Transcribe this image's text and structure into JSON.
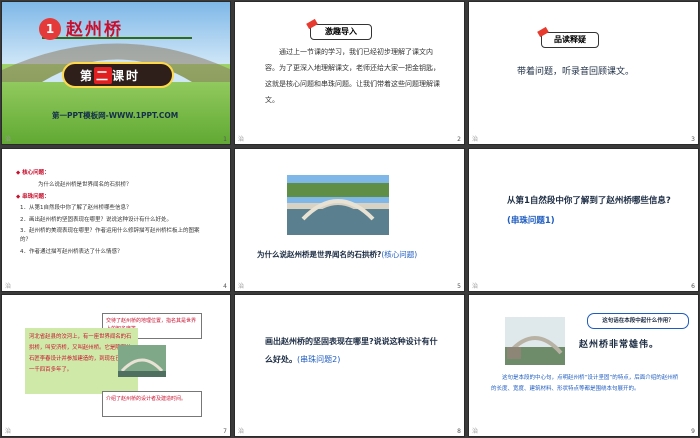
{
  "slides": [
    {
      "num": "1",
      "footer": "治",
      "title": "赵州桥",
      "badge": "1",
      "lesson": [
        "第",
        "二",
        "课时"
      ],
      "site": "第一PPT模板网-WWW.1PPT.COM"
    },
    {
      "num": "2",
      "footer": "治",
      "tag": "激趣导入",
      "text": "通过上一节课的学习，我们已经初步理解了课文内容。为了更深入地理解课文，老师还给大家一把金钥匙，这就是核心问题和串珠问题。让我们带着这些问题理解课文。"
    },
    {
      "num": "3",
      "footer": "治",
      "tag": "品读释疑",
      "text": "带着问题，听录音回顾课文。"
    },
    {
      "num": "4",
      "footer": "治",
      "core_heading": "核心问题：",
      "core_q": "为什么说赵州桥是世界闻名的石拱桥？",
      "chain_heading": "串珠问题：",
      "items": [
        "1．从第1自然段中你了解了赵州桥哪些信息？",
        "2．画出赵州桥的坚固表现在哪里？说说这种设计有什么好处。",
        "3．赵州桥的美观表现在哪里？作者运用什么修辞描写赵州桥栏板上的图案的？",
        "4．作者通过描写赵州桥表达了什么情感？"
      ]
    },
    {
      "num": "5",
      "footer": "治",
      "q": "为什么说赵州桥是世界闻名的石拱桥?",
      "tag": "(核心问题)"
    },
    {
      "num": "6",
      "footer": "治",
      "q": "从第1自然段中你了解到了赵州桥哪些信息?",
      "tag": "(串珠问题1)"
    },
    {
      "num": "7",
      "footer": "治",
      "note_top": "交待了赵州桥的地理位置，指名其是世界上的知名度等。",
      "main": "河北省赵县的洨河上，有一座世界闻名的石拱桥，叫安济桥，又叫赵州桥。它是隋朝的石匠李春设计并参加建造的，到现在已经有一千四百多年了。",
      "note_bottom": "介绍了赵州桥的设计者及建造时间。"
    },
    {
      "num": "8",
      "footer": "治",
      "q": "画出赵州桥的坚固表现在哪里?说说这种设计有什么好处。",
      "tag": "(串珠问题2)"
    },
    {
      "num": "9",
      "footer": "治",
      "bubble": "这句话在本段中起什么作用？",
      "hero": "赵州桥非常雄伟。",
      "text": "这句是本段的中心句，点明赵州桥“设计坚固”的特点，后面介绍的赵州桥的长度、宽度、建筑材料、形状特点等都是围绕本句展开的。"
    }
  ]
}
